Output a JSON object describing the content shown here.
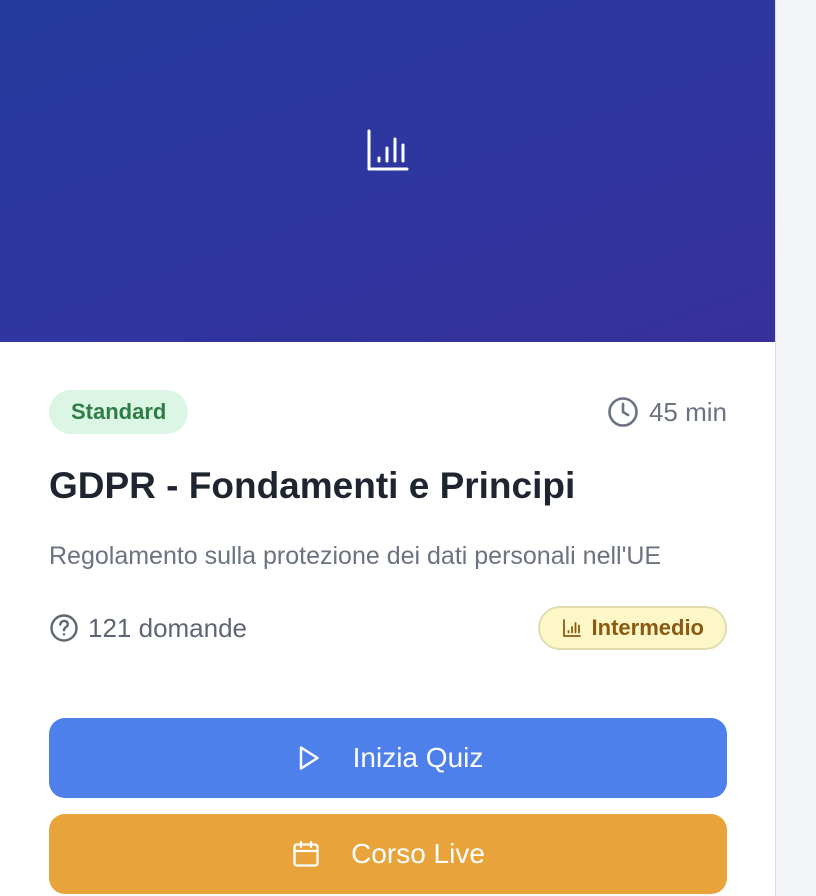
{
  "hero": {
    "icon": "bar-chart-icon",
    "gradient": [
      "#263a9e",
      "#37309a"
    ]
  },
  "card": {
    "badge": "Standard",
    "duration": "45 min",
    "title": "GDPR - Fondamenti e Principi",
    "description": "Regolamento sulla protezione dei dati personali nell'UE",
    "questions": "121 domande",
    "level": "Intermedio",
    "actions": {
      "start_quiz": "Inizia Quiz",
      "live_course": "Corso Live"
    }
  },
  "colors": {
    "primary": "#4e80ec",
    "live": "#e8a33a",
    "badge_green_bg": "#dcf6e6",
    "badge_green_text": "#2e7d45",
    "level_bg": "#fdf7c8",
    "level_text": "#8a5a10"
  }
}
